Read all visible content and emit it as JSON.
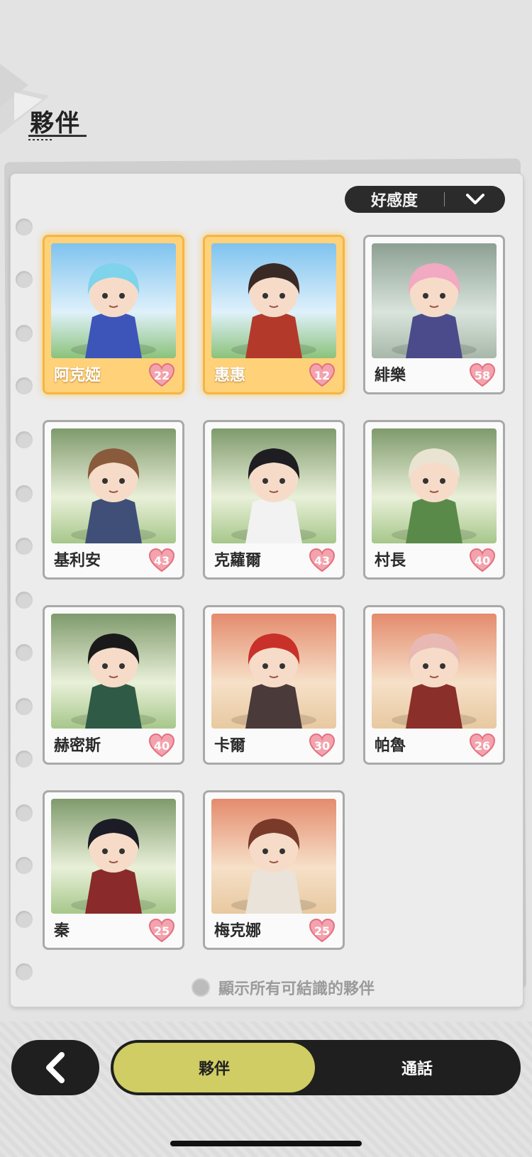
{
  "header": {
    "title": "夥伴"
  },
  "sort": {
    "label": "好感度",
    "icon": "chevron-down-icon"
  },
  "companions": [
    {
      "name": "阿克婭",
      "affinity": "22",
      "highlight": true,
      "bg": "sky",
      "hair": "#7fd3ea",
      "outfit": "#3d55b8"
    },
    {
      "name": "惠惠",
      "affinity": "12",
      "highlight": true,
      "bg": "sky",
      "hair": "#3a2a26",
      "outfit": "#b33a2a"
    },
    {
      "name": "緋樂",
      "affinity": "58",
      "highlight": false,
      "bg": "ruin",
      "hair": "#f2a9c2",
      "outfit": "#4b4a8a"
    },
    {
      "name": "基利安",
      "affinity": "43",
      "highlight": false,
      "bg": "forest",
      "hair": "#8a5a3c",
      "outfit": "#3f4f77"
    },
    {
      "name": "克蘿爾",
      "affinity": "43",
      "highlight": false,
      "bg": "forest",
      "hair": "#1d1d22",
      "outfit": "#f2f2f2"
    },
    {
      "name": "村長",
      "affinity": "40",
      "highlight": false,
      "bg": "forest",
      "hair": "#e9e4d1",
      "outfit": "#5a8a4a"
    },
    {
      "name": "赫密斯",
      "affinity": "40",
      "highlight": false,
      "bg": "forest",
      "hair": "#1a1a1a",
      "outfit": "#2f5a46"
    },
    {
      "name": "卡爾",
      "affinity": "30",
      "highlight": false,
      "bg": "desert",
      "hair": "#c9302a",
      "outfit": "#4a3a3a"
    },
    {
      "name": "帕魯",
      "affinity": "26",
      "highlight": false,
      "bg": "desert",
      "hair": "#e8b9b4",
      "outfit": "#8a2f2a"
    },
    {
      "name": "秦",
      "affinity": "25",
      "highlight": false,
      "bg": "forest",
      "hair": "#1c1c26",
      "outfit": "#8a2a2a"
    },
    {
      "name": "梅克娜",
      "affinity": "25",
      "highlight": false,
      "bg": "desert",
      "hair": "#7a3a2a",
      "outfit": "#e9e3da"
    }
  ],
  "show_all": {
    "label": "顯示所有可結識的夥伴"
  },
  "nav": {
    "back_icon": "chevron-left-icon",
    "tabs": [
      {
        "label": "夥伴",
        "active": true
      },
      {
        "label": "通話",
        "active": false
      }
    ]
  },
  "colors": {
    "accent_tab": "#cfcd63",
    "highlight_card": "#ffd27a",
    "heart": "#f07a8a",
    "dark": "#1f1f1f"
  }
}
